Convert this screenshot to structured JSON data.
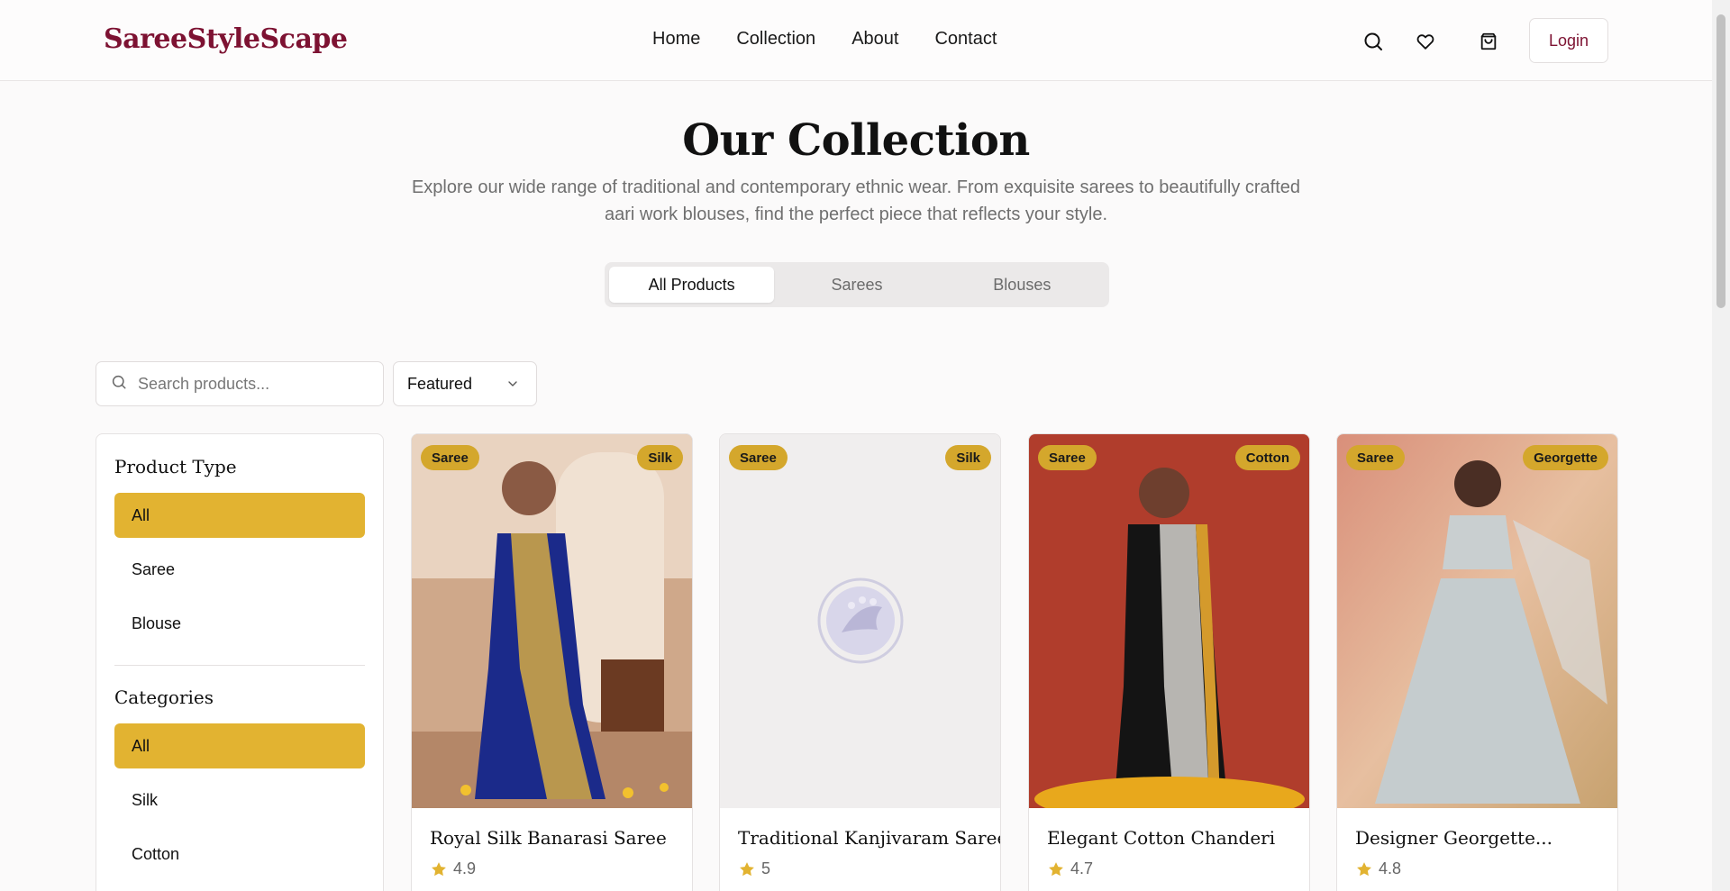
{
  "header": {
    "logo": "SareeStyleScape",
    "nav": [
      "Home",
      "Collection",
      "About",
      "Contact"
    ],
    "login_label": "Login",
    "icons": [
      "search-icon",
      "heart-icon",
      "shopping-bag-icon"
    ]
  },
  "hero": {
    "title": "Our Collection",
    "subtitle": "Explore our wide range of traditional and contemporary ethnic wear. From exquisite sarees to beautifully crafted aari work blouses, find the perfect piece that reflects your style."
  },
  "tabs": [
    {
      "label": "All Products",
      "active": true
    },
    {
      "label": "Sarees",
      "active": false
    },
    {
      "label": "Blouses",
      "active": false
    }
  ],
  "toolbar": {
    "search_placeholder": "Search products...",
    "sort_value": "Featured"
  },
  "sidebar": {
    "product_type_heading": "Product Type",
    "product_types": [
      "All",
      "Saree",
      "Blouse"
    ],
    "categories_heading": "Categories",
    "categories": [
      "All",
      "Silk",
      "Cotton"
    ]
  },
  "products": [
    {
      "name": "Royal Silk Banarasi Saree",
      "type": "Saree",
      "material": "Silk",
      "rating": "4.9"
    },
    {
      "name": "Traditional Kanjivaram Saree",
      "type": "Saree",
      "material": "Silk",
      "rating": "5"
    },
    {
      "name": "Elegant Cotton Chanderi",
      "type": "Saree",
      "material": "Cotton",
      "rating": "4.7"
    },
    {
      "name": "Designer Georgette...",
      "type": "Saree",
      "material": "Georgette",
      "rating": "4.8"
    }
  ],
  "colors": {
    "brand": "#7d1232",
    "accent": "#e2b331",
    "badge": "#d4a72c"
  }
}
